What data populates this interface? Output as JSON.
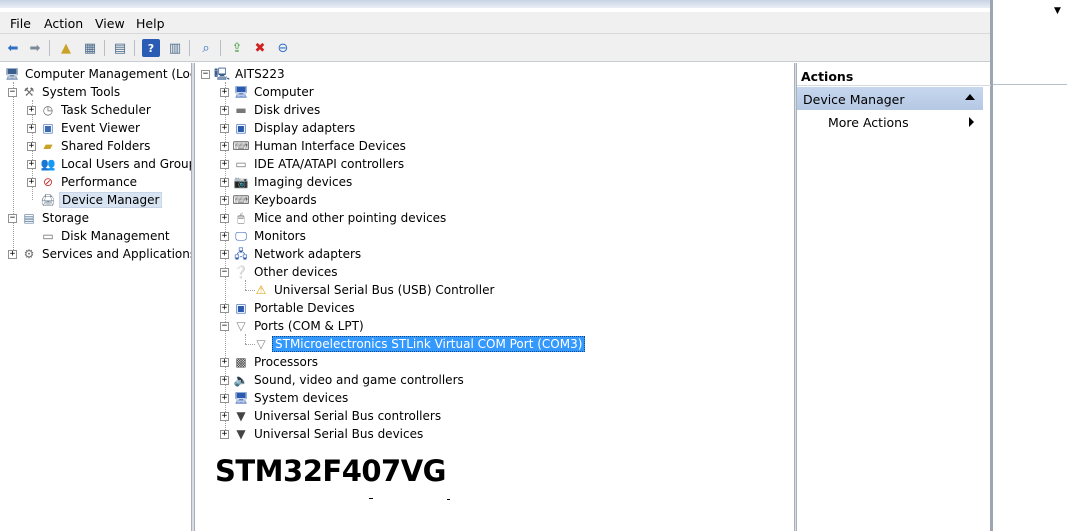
{
  "menu": {
    "file": "File",
    "action": "Action",
    "view": "View",
    "help": "Help"
  },
  "left_tree": {
    "root": "Computer Management (Local",
    "system_tools": "System Tools",
    "task_scheduler": "Task Scheduler",
    "event_viewer": "Event Viewer",
    "shared_folders": "Shared Folders",
    "local_users_groups": "Local Users and Groups",
    "performance": "Performance",
    "device_manager": "Device Manager",
    "storage": "Storage",
    "disk_management": "Disk Management",
    "services_apps": "Services and Applications"
  },
  "device_tree": {
    "root": "AITS223",
    "computer": "Computer",
    "disk_drives": "Disk drives",
    "display_adapters": "Display adapters",
    "hid": "Human Interface Devices",
    "ide": "IDE ATA/ATAPI controllers",
    "imaging": "Imaging devices",
    "keyboards": "Keyboards",
    "mice": "Mice and other pointing devices",
    "monitors": "Monitors",
    "network": "Network adapters",
    "other": "Other devices",
    "usb_controller_unknown": "Universal Serial Bus (USB) Controller",
    "portable": "Portable Devices",
    "ports": "Ports (COM & LPT)",
    "stlink_port": "STMicroelectronics STLink Virtual COM Port (COM3)",
    "processors": "Processors",
    "sound": "Sound, video and game controllers",
    "system_devices": "System devices",
    "usb_controllers": "Universal Serial Bus controllers",
    "usb_devices": "Universal Serial Bus devices"
  },
  "actions": {
    "header": "Actions",
    "section": "Device Manager",
    "more": "More Actions"
  },
  "caption": "STM32F407VG"
}
